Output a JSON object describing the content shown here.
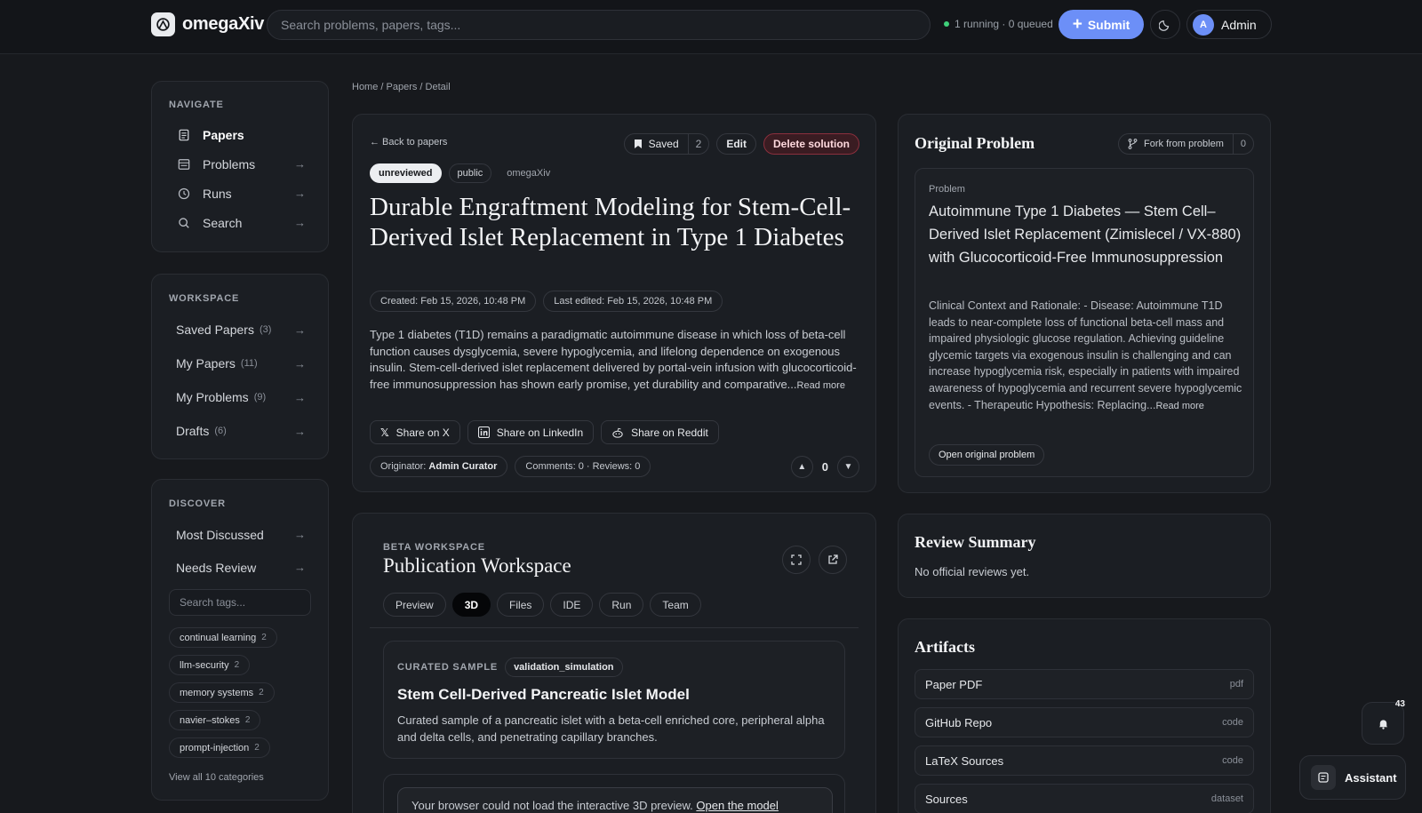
{
  "topbar": {
    "logo_text": "omegaXiv",
    "search_placeholder": "Search problems, papers, tags...",
    "status": "1 running · 0 queued",
    "submit_label": "Submit",
    "user_initial": "A",
    "user_name": "Admin"
  },
  "sidebar": {
    "navigate_title": "NAVIGATE",
    "nav": [
      {
        "label": "Papers",
        "icon": "document-icon"
      },
      {
        "label": "Problems",
        "icon": "list-icon"
      },
      {
        "label": "Runs",
        "icon": "clock-icon"
      },
      {
        "label": "Search",
        "icon": "search-icon"
      }
    ],
    "workspace_title": "WORKSPACE",
    "workspace": [
      {
        "label": "Saved Papers",
        "count": "(3)"
      },
      {
        "label": "My Papers",
        "count": "(11)"
      },
      {
        "label": "My Problems",
        "count": "(9)"
      },
      {
        "label": "Drafts",
        "count": "(6)"
      }
    ],
    "discover_title": "DISCOVER",
    "discover": [
      {
        "label": "Most Discussed"
      },
      {
        "label": "Needs Review"
      }
    ],
    "tag_search_placeholder": "Search tags...",
    "tags": [
      {
        "label": "continual learning",
        "count": "2"
      },
      {
        "label": "llm-security",
        "count": "2"
      },
      {
        "label": "memory systems",
        "count": "2"
      },
      {
        "label": "navier–stokes",
        "count": "2"
      },
      {
        "label": "prompt-injection",
        "count": "2"
      }
    ],
    "view_all": "View all 10 categories",
    "arrow": "→"
  },
  "breadcrumb": "Home / Papers / Detail",
  "paper": {
    "back": "← Back to papers",
    "saved_label": "Saved",
    "saved_count": "2",
    "edit_label": "Edit",
    "delete_label": "Delete solution",
    "badge_status": "unreviewed",
    "badge_visibility": "public",
    "badge_source": "omegaXiv",
    "title": "Durable Engraftment Modeling for Stem-Cell-Derived Islet Replacement in Type 1 Diabetes",
    "created": "Created: Feb 15, 2026, 10:48 PM",
    "last_edited": "Last edited: Feb 15, 2026, 10:48 PM",
    "abstract": "Type 1 diabetes (T1D) remains a paradigmatic autoimmune disease in which loss of beta-cell function causes dysglycemia, severe hypoglycemia, and lifelong dependence on exogenous insulin. Stem-cell-derived islet replacement delivered by portal-vein infusion with glucocorticoid-free immunosuppression has shown early promise, yet durability and comparative...",
    "read_more": "Read more",
    "share_x": "Share on X",
    "share_linkedin": "Share on LinkedIn",
    "share_reddit": "Share on Reddit",
    "originator_prefix": "Originator:",
    "originator_name": "Admin Curator",
    "comments_reviews": "Comments: 0 · Reviews: 0",
    "votes": "0"
  },
  "workspace": {
    "kicker": "BETA WORKSPACE",
    "title": "Publication Workspace",
    "tabs": [
      "Preview",
      "3D",
      "Files",
      "IDE",
      "Run",
      "Team"
    ],
    "active_tab": "3D",
    "sample_kicker": "CURATED SAMPLE",
    "sample_badge": "validation_simulation",
    "sample_title": "Stem Cell-Derived Pancreatic Islet Model",
    "sample_desc": "Curated sample of a pancreatic islet with a beta-cell enriched core, peripheral alpha and delta cells, and penetrating capillary branches.",
    "fallback_text": "Your browser could not load the interactive 3D preview.",
    "fallback_link": "Open the model"
  },
  "original_problem": {
    "heading": "Original Problem",
    "fork_label": "Fork from problem",
    "fork_count": "0",
    "kicker": "Problem",
    "title": "Autoimmune Type 1 Diabetes — Stem Cell–Derived Islet Replacement (Zimislecel / VX-880) with Glucocorticoid-Free Immunosuppression",
    "body": "Clinical Context and Rationale: - Disease: Autoimmune T1D leads to near-complete loss of functional beta-cell mass and impaired physiologic glucose regulation. Achieving guideline glycemic targets via exogenous insulin is challenging and can increase hypoglycemia risk, especially in patients with impaired awareness of hypoglycemia and recurrent severe hypoglycemic events. - Therapeutic Hypothesis: Replacing...",
    "read_more": "Read more",
    "open_label": "Open original problem"
  },
  "review_summary": {
    "heading": "Review Summary",
    "text": "No official reviews yet."
  },
  "artifacts": {
    "heading": "Artifacts",
    "items": [
      {
        "label": "Paper PDF",
        "type": "pdf"
      },
      {
        "label": "GitHub Repo",
        "type": "code"
      },
      {
        "label": "LaTeX Sources",
        "type": "code"
      },
      {
        "label": "Sources",
        "type": "dataset"
      }
    ]
  },
  "floating": {
    "notification_count": "43",
    "assistant_label": "Assistant"
  },
  "colors": {
    "accent": "#6c8ff7",
    "background": "#17191d",
    "panel": "#1b1e23",
    "danger": "#8a2f3d",
    "status_running": "#3fd07a"
  }
}
